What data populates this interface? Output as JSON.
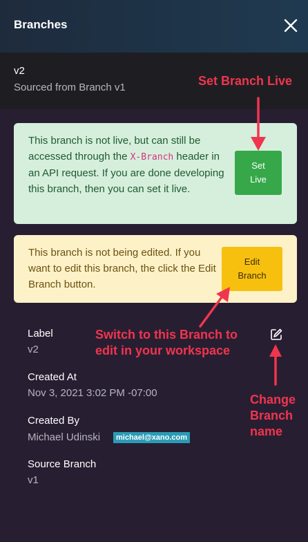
{
  "header": {
    "title": "Branches"
  },
  "branch": {
    "name": "v2",
    "source_text": "Sourced from Branch v1"
  },
  "live_alert": {
    "text_before": "This branch is not live, but can still be accessed through the ",
    "code": "X-Branch",
    "text_after": " header in an API request. If you are done developing this branch, then you can set it live.",
    "button_line1": "Set",
    "button_line2": "Live"
  },
  "edit_alert": {
    "text": "This branch is not being edited. If you want to edit this branch, the click the Edit Branch button.",
    "button_line1": "Edit",
    "button_line2": "Branch"
  },
  "details": {
    "label_title": "Label",
    "label_value": "v2",
    "created_at_title": "Created At",
    "created_at_value": "Nov 3, 2021 3:02 PM -07:00",
    "created_by_title": "Created By",
    "created_by_name": "Michael Udinski",
    "created_by_email": "michael@xano.com",
    "source_title": "Source Branch",
    "source_value": "v1"
  },
  "annotations": {
    "set_live": "Set Branch Live",
    "switch_line1": "Switch to this Branch to",
    "switch_line2": "edit in your workspace",
    "change_line1": "Change",
    "change_line2": "Branch",
    "change_line3": "name"
  },
  "colors": {
    "annotation": "#f0354e",
    "set_live_button": "#36a84a",
    "edit_button": "#f7c00f",
    "email_badge": "#2b9bb5"
  },
  "icons": {
    "close": "close-icon",
    "edit": "edit-pencil-icon"
  }
}
